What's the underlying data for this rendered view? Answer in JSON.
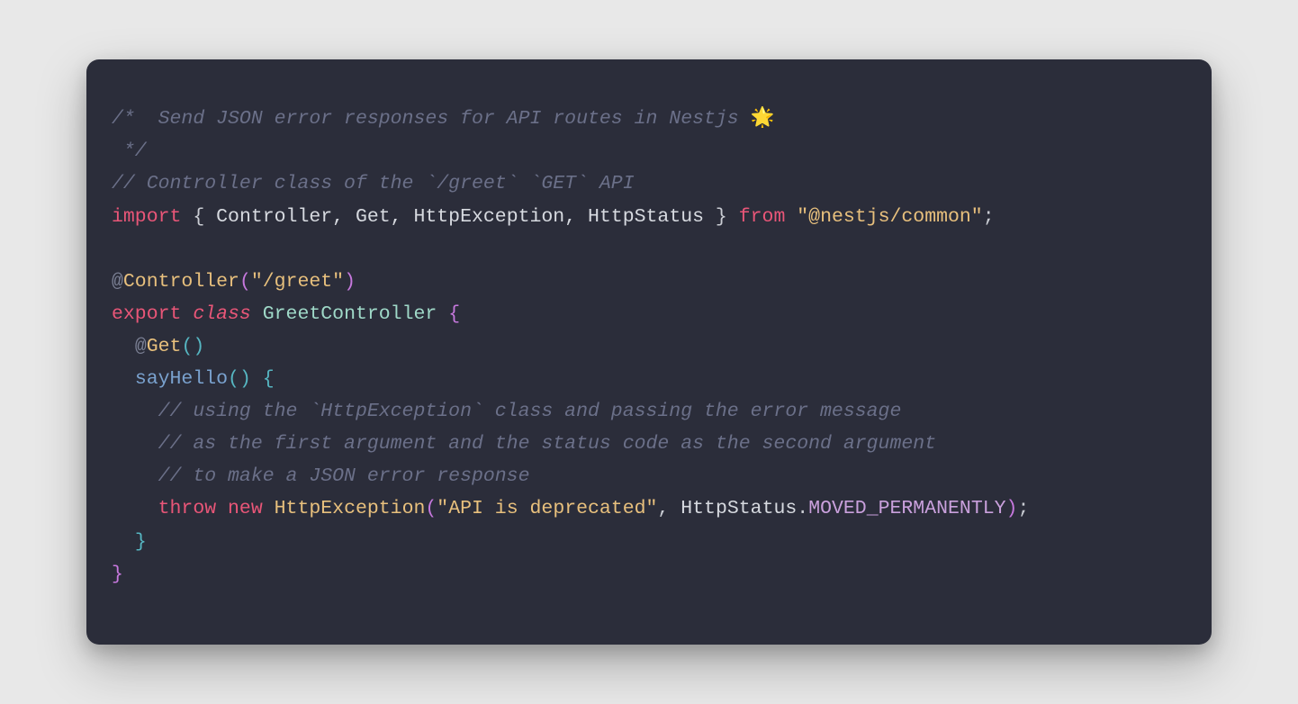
{
  "code": {
    "line1_a": "/*  Send JSON error responses for API routes in Nestjs ",
    "line1_emoji": "🌟",
    "line2": " */",
    "line3": "// Controller class of the `/greet` `GET` API",
    "line4_import": "import",
    "line4_brace_open": " { ",
    "line4_names": "Controller, Get, HttpException, HttpStatus",
    "line4_brace_close": " } ",
    "line4_from": "from",
    "line4_space": " ",
    "line4_str": "\"@nestjs/common\"",
    "line4_semi": ";",
    "blank": "",
    "line6_at": "@",
    "line6_ctrl": "Controller",
    "line6_p_open": "(",
    "line6_str": "\"/greet\"",
    "line6_p_close": ")",
    "line7_export": "export",
    "line7_sp": " ",
    "line7_class": "class",
    "line7_sp2": " ",
    "line7_name": "GreetController",
    "line7_sp3": " ",
    "line7_brace": "{",
    "line8_indent": "  ",
    "line8_at": "@",
    "line8_get": "Get",
    "line8_p_open": "(",
    "line8_p_close": ")",
    "line9_indent": "  ",
    "line9_fn": "sayHello",
    "line9_p_open": "(",
    "line9_p_close": ")",
    "line9_sp": " ",
    "line9_brace": "{",
    "line10_indent": "    ",
    "line10": "// using the `HttpException` class and passing the error message",
    "line11_indent": "    ",
    "line11": "// as the first argument and the status code as the second argument",
    "line12_indent": "    ",
    "line12": "// to make a JSON error response",
    "line13_indent": "    ",
    "line13_throw": "throw",
    "line13_sp": " ",
    "line13_new": "new",
    "line13_sp2": " ",
    "line13_cls": "HttpException",
    "line13_p_open": "(",
    "line13_str": "\"API is deprecated\"",
    "line13_comma": ", ",
    "line13_obj": "HttpStatus",
    "line13_dot": ".",
    "line13_const": "MOVED_PERMANENTLY",
    "line13_p_close": ")",
    "line13_semi": ";",
    "line14_indent": "  ",
    "line14_brace": "}",
    "line15_brace": "}"
  }
}
